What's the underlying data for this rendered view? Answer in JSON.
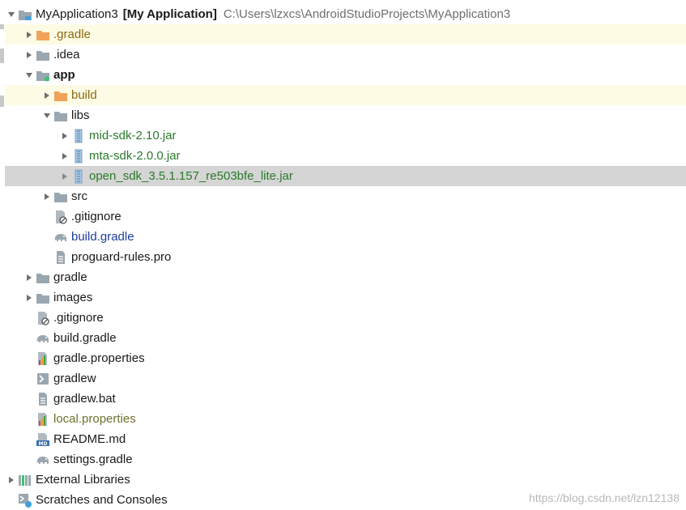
{
  "tree": {
    "root": {
      "name": "MyApplication3",
      "module": "[My Application]",
      "path": "C:\\Users\\lzxcs\\AndroidStudioProjects\\MyApplication3"
    },
    "items": [
      {
        "label": ".gradle"
      },
      {
        "label": ".idea"
      },
      {
        "label": "app"
      },
      {
        "label": "build"
      },
      {
        "label": "libs"
      },
      {
        "label": "mid-sdk-2.10.jar"
      },
      {
        "label": "mta-sdk-2.0.0.jar"
      },
      {
        "label": "open_sdk_3.5.1.157_re503bfe_lite.jar"
      },
      {
        "label": "src"
      },
      {
        "label": ".gitignore"
      },
      {
        "label": "build.gradle"
      },
      {
        "label": "proguard-rules.pro"
      },
      {
        "label": "gradle"
      },
      {
        "label": "images"
      },
      {
        "label": ".gitignore"
      },
      {
        "label": "build.gradle"
      },
      {
        "label": "gradle.properties"
      },
      {
        "label": "gradlew"
      },
      {
        "label": "gradlew.bat"
      },
      {
        "label": "local.properties"
      },
      {
        "label": "README.md"
      },
      {
        "label": "settings.gradle"
      },
      {
        "label": "External Libraries"
      },
      {
        "label": "Scratches and Consoles"
      }
    ]
  },
  "watermark": "https://blog.csdn.net/lzn12138",
  "colors": {
    "excluded_highlight": "#fdfbe3",
    "selected_row": "#d5d5d5",
    "excluded_text": "#8b6914",
    "library_text": "#2a7a2a",
    "modified_text": "#1f3f9a",
    "folder_gray": "#9aa7b0",
    "folder_orange": "#f0a35a"
  }
}
